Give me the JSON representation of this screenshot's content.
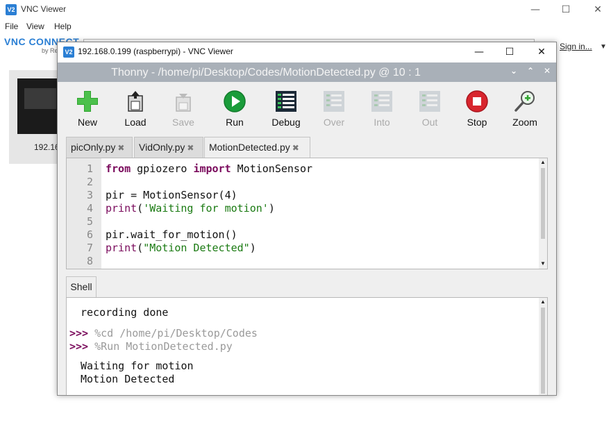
{
  "outer": {
    "app_icon": "V2",
    "title": "VNC Viewer",
    "menu": [
      "File",
      "View",
      "Help"
    ],
    "brand": "VNC CONNECT",
    "brand_sub": "by Re",
    "signin": "Sign in...",
    "thumb_label": "192.16"
  },
  "inner": {
    "app_icon": "V2",
    "title": "192.168.0.199 (raspberrypi) - VNC Viewer"
  },
  "thonny": {
    "title": "Thonny  -  /home/pi/Desktop/Codes/MotionDetected.py  @  10 : 1",
    "toolbar": [
      {
        "label": "New",
        "icon": "new-file-icon",
        "enabled": true
      },
      {
        "label": "Load",
        "icon": "load-icon",
        "enabled": true
      },
      {
        "label": "Save",
        "icon": "save-icon",
        "enabled": false
      },
      {
        "label": "Run",
        "icon": "run-icon",
        "enabled": true
      },
      {
        "label": "Debug",
        "icon": "debug-icon",
        "enabled": true
      },
      {
        "label": "Over",
        "icon": "step-over-icon",
        "enabled": false
      },
      {
        "label": "Into",
        "icon": "step-into-icon",
        "enabled": false
      },
      {
        "label": "Out",
        "icon": "step-out-icon",
        "enabled": false
      },
      {
        "label": "Stop",
        "icon": "stop-icon",
        "enabled": true
      },
      {
        "label": "Zoom",
        "icon": "zoom-icon",
        "enabled": true
      }
    ],
    "tabs": [
      {
        "label": "picOnly.py",
        "active": false
      },
      {
        "label": "VidOnly.py",
        "active": false
      },
      {
        "label": "MotionDetected.py",
        "active": true
      }
    ],
    "line_numbers": [
      "1",
      "2",
      "3",
      "4",
      "5",
      "6",
      "7",
      "8"
    ],
    "shell_tab": "Shell",
    "shell": {
      "out1": "recording done",
      "prompt": ">>>",
      "cmd1": "%cd /home/pi/Desktop/Codes",
      "cmd2": "%Run MotionDetected.py",
      "out2": "Waiting for motion",
      "out3": "Motion Detected"
    },
    "code": {
      "l1_kw1": "from",
      "l1_mod": " gpiozero ",
      "l1_kw2": "import",
      "l1_name": " MotionSensor",
      "l3": "pir = MotionSensor(4)",
      "l4_fn": "print",
      "l4_p1": "(",
      "l4_str": "'Waiting for motion'",
      "l4_p2": ")",
      "l6": "pir.wait_for_motion()",
      "l7_fn": "print",
      "l7_p1": "(",
      "l7_str": "\"Motion Detected\"",
      "l7_p2": ")"
    }
  }
}
